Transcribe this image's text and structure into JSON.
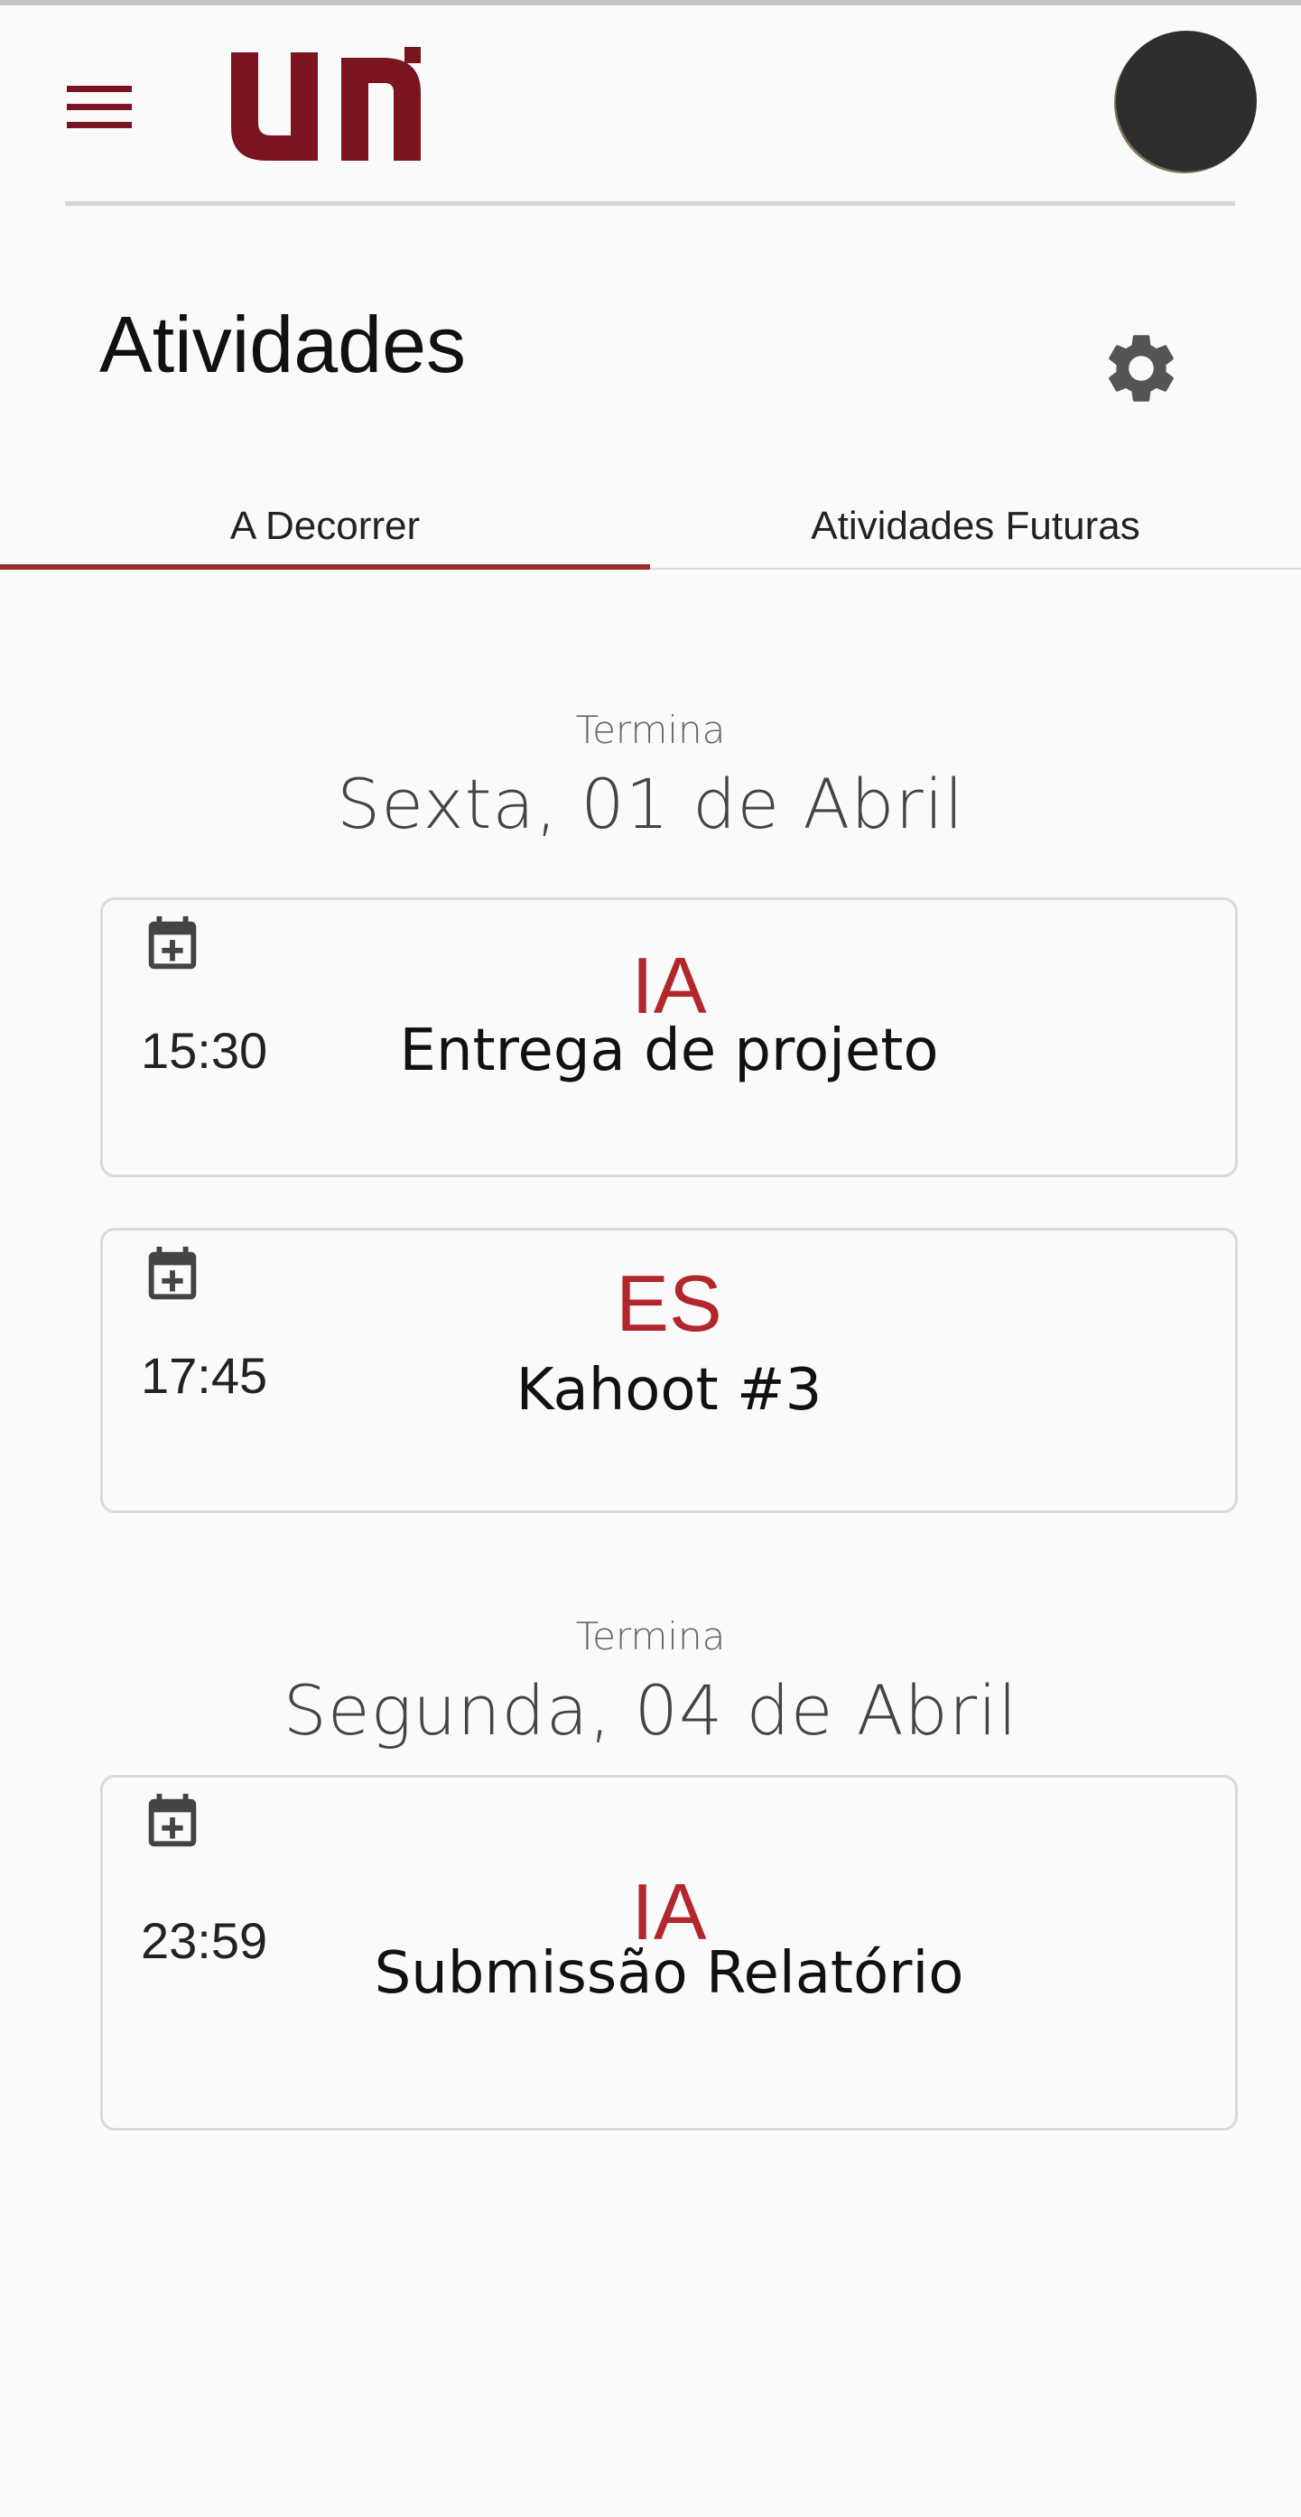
{
  "app": {
    "brand": "uni",
    "brand_color": "#7a1420",
    "accent_color": "#b1272c"
  },
  "header": {
    "title": "Atividades"
  },
  "tabs": [
    {
      "label": "A Decorrer",
      "active": true
    },
    {
      "label": "Atividades Futuras",
      "active": false
    }
  ],
  "groups": [
    {
      "ends_label": "Termina",
      "date": "Sexta, 01 de Abril",
      "activities": [
        {
          "time": "15:30",
          "subject": "IA",
          "title": "Entrega de projeto",
          "icon": "calendar-plus-icon"
        },
        {
          "time": "17:45",
          "subject": "ES",
          "title": "Kahoot #3",
          "icon": "calendar-plus-icon"
        }
      ]
    },
    {
      "ends_label": "Termina",
      "date": "Segunda, 04 de Abril",
      "activities": [
        {
          "time": "23:59",
          "subject": "IA",
          "title": "Submissão Relatório",
          "icon": "calendar-plus-icon"
        }
      ]
    }
  ]
}
